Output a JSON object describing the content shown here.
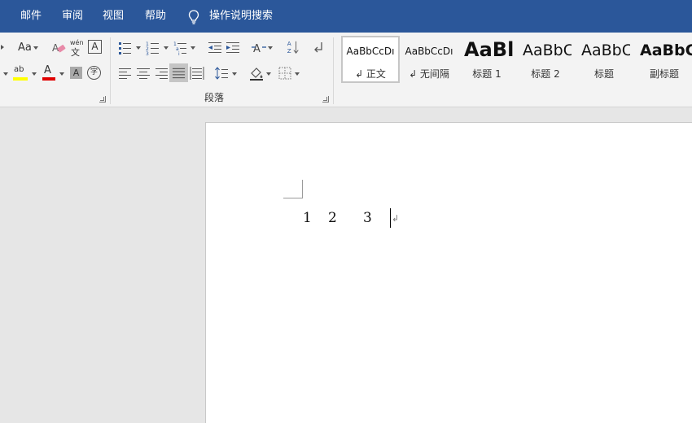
{
  "menu": {
    "items": [
      "邮件",
      "审阅",
      "视图",
      "帮助"
    ],
    "search_label": "操作说明搜索"
  },
  "ribbon": {
    "font_group": {
      "case_label": "Aa",
      "phonetic_label": "wén",
      "phonetic_char": "文",
      "char_border_label": "A",
      "highlight_label": "ab",
      "font_color_label": "A",
      "shading_label": "A",
      "enclose_label": "字"
    },
    "paragraph_group": {
      "label": "段落"
    },
    "styles": [
      {
        "preview": "AaBbCcDı",
        "name": "↲ 正文",
        "selected": true
      },
      {
        "preview": "AaBbCcDı",
        "name": "↲ 无间隔",
        "selected": false
      },
      {
        "preview": "AaBl",
        "name": "标题 1",
        "selected": false
      },
      {
        "preview": "AaBbC",
        "name": "标题 2",
        "selected": false
      },
      {
        "preview": "AaBbC",
        "name": "标题",
        "selected": false
      },
      {
        "preview": "AaBbC",
        "name": "副标题",
        "selected": false
      }
    ]
  },
  "document": {
    "chars": [
      "1",
      "2",
      "3"
    ],
    "paragraph_mark": "↲"
  },
  "colors": {
    "menubar": "#2b579a",
    "highlight": "#ffff00",
    "font_color": "#e00000"
  }
}
